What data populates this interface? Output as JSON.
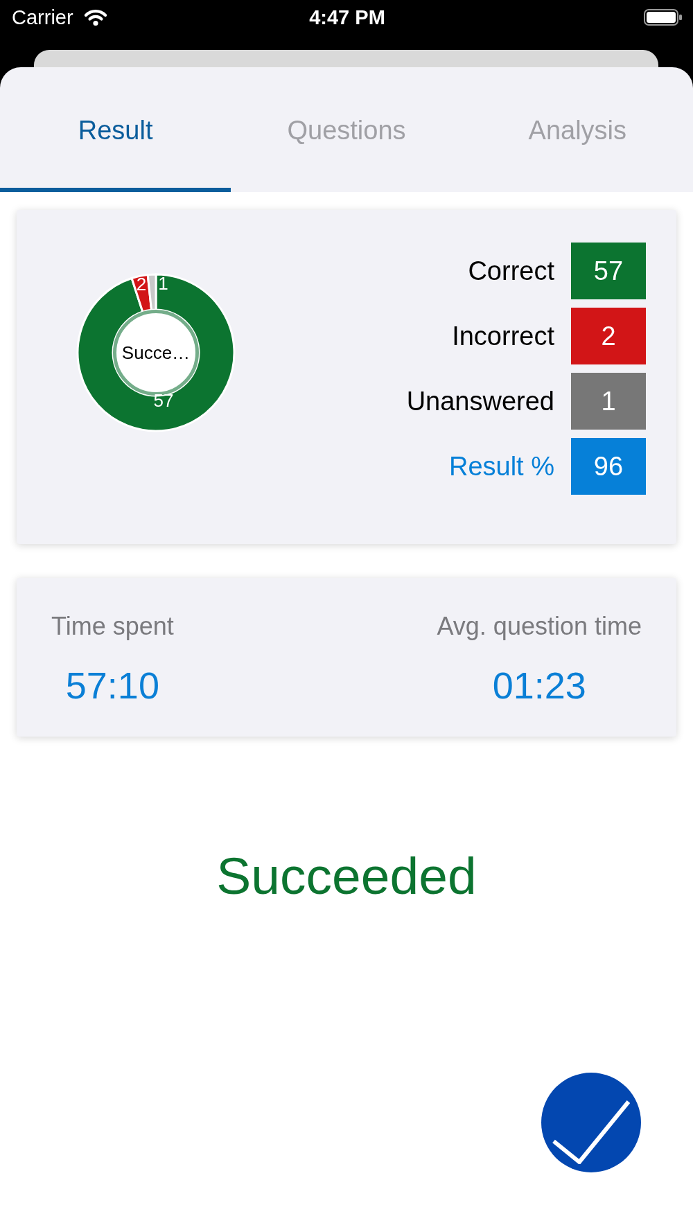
{
  "status_bar": {
    "carrier": "Carrier",
    "time": "4:47 PM"
  },
  "tabs": [
    {
      "label": "Result",
      "selected": true
    },
    {
      "label": "Questions",
      "selected": false
    },
    {
      "label": "Analysis",
      "selected": false
    }
  ],
  "summary": {
    "donut": {
      "center_label": "Succe…",
      "chart_data": {
        "type": "donut",
        "values": [
          57,
          2,
          1
        ],
        "data_labels": true
      }
    },
    "stats": [
      {
        "label": "Correct",
        "value": "57",
        "color": "#0c7430",
        "kind": "count"
      },
      {
        "label": "Incorrect",
        "value": "2",
        "color": "#d21517",
        "kind": "count"
      },
      {
        "label": "Unanswered",
        "value": "1",
        "color": "#777777",
        "kind": "count"
      },
      {
        "label": "Result %",
        "value": "96",
        "color": "#0680d8",
        "kind": "percent"
      }
    ]
  },
  "timing": [
    {
      "label": "Time spent",
      "value": "57:10"
    },
    {
      "label": "Avg. question time",
      "value": "01:23"
    }
  ],
  "outcome": "Succeeded"
}
